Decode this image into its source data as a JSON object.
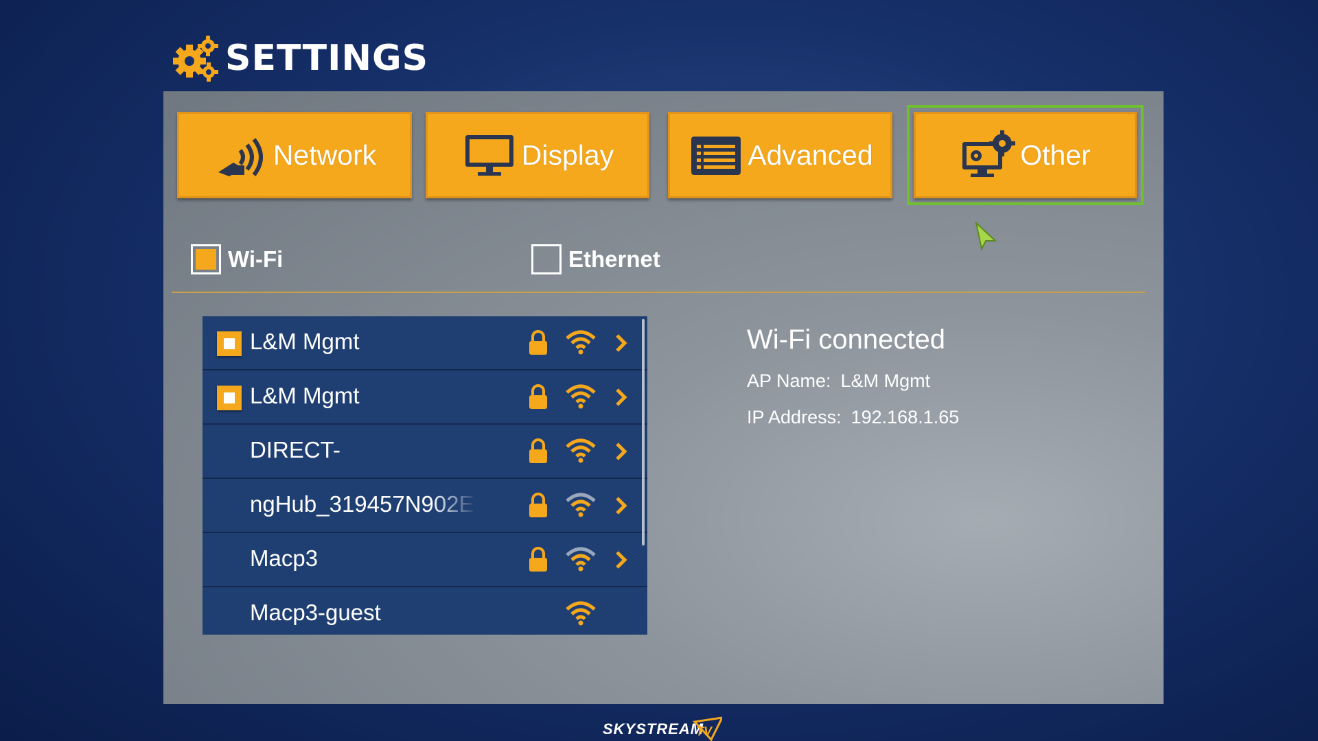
{
  "header": {
    "title": "SETTINGS",
    "icon": "gears-icon"
  },
  "tabs": [
    {
      "label": "Network",
      "icon": "network-signal-icon"
    },
    {
      "label": "Display",
      "icon": "monitor-icon"
    },
    {
      "label": "Advanced",
      "icon": "list-icon"
    },
    {
      "label": "Other",
      "icon": "gear-monitor-icon",
      "focused": true
    }
  ],
  "connection": {
    "wifi_label": "Wi-Fi",
    "wifi_checked": true,
    "ethernet_label": "Ethernet",
    "ethernet_checked": false
  },
  "networks": [
    {
      "ssid": "L&M Mgmt",
      "selected": true,
      "locked": true,
      "signal": "strong"
    },
    {
      "ssid": "L&M Mgmt",
      "selected": true,
      "locked": true,
      "signal": "strong"
    },
    {
      "ssid": "DIRECT-",
      "selected": false,
      "locked": true,
      "signal": "strong"
    },
    {
      "ssid": "ngHub_319457N902E",
      "selected": false,
      "locked": true,
      "signal": "medium"
    },
    {
      "ssid": "Macp3",
      "selected": false,
      "locked": true,
      "signal": "medium"
    },
    {
      "ssid": "Macp3-guest",
      "selected": false,
      "locked": false,
      "signal": "strong"
    }
  ],
  "info": {
    "status": "Wi-Fi connected",
    "ap_name_label": "AP Name:",
    "ap_name_value": "L&M Mgmt",
    "ip_label": "IP Address:",
    "ip_value": "192.168.1.65"
  },
  "colors": {
    "accent": "#f6a81c",
    "focus": "#6fbf2f",
    "list_bg": "#1f3f73"
  },
  "footer": {
    "brand": "SKYSTREAMTV"
  }
}
